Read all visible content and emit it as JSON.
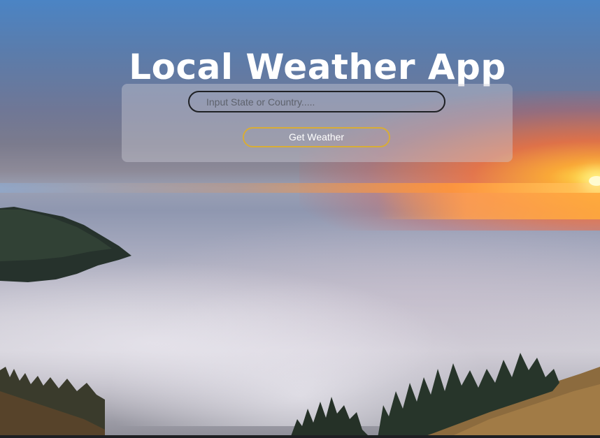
{
  "app": {
    "title": "Local Weather App"
  },
  "search": {
    "placeholder": "Input State or Country.....",
    "value": ""
  },
  "actions": {
    "get_weather_label": "Get Weather"
  },
  "colors": {
    "button_border": "#d8ad36",
    "input_border": "#1f2125",
    "title_text": "#ffffff"
  }
}
